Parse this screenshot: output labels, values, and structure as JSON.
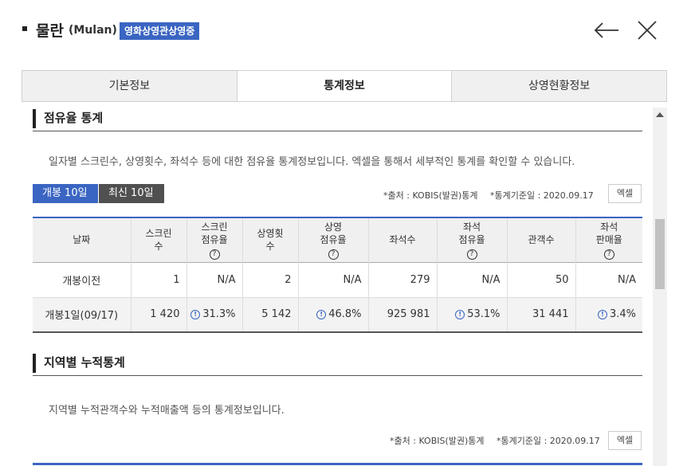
{
  "header": {
    "title": "물란",
    "title_en": "(Mulan)",
    "status_badge": "영화상영관상영중",
    "accent_color": "#3a65c2"
  },
  "tabs": [
    {
      "label": "기본정보",
      "active": false
    },
    {
      "label": "통계정보",
      "active": true
    },
    {
      "label": "상영현황정보",
      "active": false
    }
  ],
  "occupancy": {
    "title": "점유율 통계",
    "description": "일자별 스크린수, 상영횟수, 좌석수 등에 대한 점유율 통계정보입니다. 엑셀을 통해서 세부적인 통계를 확인할 수 있습니다.",
    "period_buttons": [
      "개봉 10일",
      "최신 10일"
    ],
    "source": "*출처 : KOBIS(발권)통계",
    "base_date": "*통계기준일 : 2020.09.17",
    "excel_label": "엑셀",
    "columns": [
      {
        "line1": "날짜",
        "line2": "",
        "help": false
      },
      {
        "line1": "스크린",
        "line2": "수",
        "help": false
      },
      {
        "line1": "스크린",
        "line2": "점유율",
        "help": true
      },
      {
        "line1": "상영횟",
        "line2": "수",
        "help": false
      },
      {
        "line1": "상영",
        "line2": "점유율",
        "help": true
      },
      {
        "line1": "좌석수",
        "line2": "",
        "help": false
      },
      {
        "line1": "좌석",
        "line2": "점유율",
        "help": true
      },
      {
        "line1": "관객수",
        "line2": "",
        "help": false
      },
      {
        "line1": "좌석",
        "line2": "판매율",
        "help": true
      }
    ],
    "rows": [
      {
        "date": "개봉이전",
        "screens": "1",
        "screen_share": "N/A",
        "shows": "2",
        "show_share": "N/A",
        "seats": "279",
        "seat_share": "N/A",
        "audience": "50",
        "sales_rate": "N/A"
      },
      {
        "date": "개봉1일(09/17)",
        "screens": "1 420",
        "screen_share": "31.3%",
        "shows": "5 142",
        "show_share": "46.8%",
        "seats": "925 981",
        "seat_share": "53.1%",
        "audience": "31 441",
        "sales_rate": "3.4%"
      }
    ]
  },
  "regional": {
    "title": "지역별 누적통계",
    "description": "지역별 누적관객수와 누적매출액 등의 통계정보입니다.",
    "source": "*출처 : KOBIS(발권)통계",
    "base_date": "*통계기준일 : 2020.09.17",
    "excel_label": "엑셀"
  },
  "glyphs": {
    "help": "?",
    "info": "!"
  }
}
